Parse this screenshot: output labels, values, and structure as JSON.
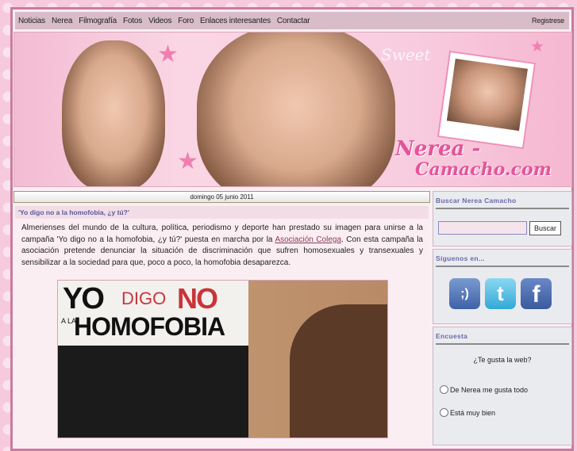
{
  "nav": {
    "items": [
      "Noticias",
      "Nerea",
      "Filmografía",
      "Fotos",
      "Videos",
      "Foro",
      "Enlaces interesantes",
      "Contactar"
    ],
    "register": "Registrese"
  },
  "banner": {
    "logo_line1": "Nerea -",
    "logo_line2": "Camacho.com",
    "sweet": "Sweet"
  },
  "post": {
    "date": "domingo 05 junio 2011",
    "title": "'Yo digo no a la homofobia, ¿y tú?'",
    "text_before": "Almerienses del mundo de la cultura, política, periodismo y deporte han prestado su imagen para unirse a la campaña 'Yo digo no a la homofobia, ¿y tú?' puesta en marcha por la ",
    "link": "Asociación Colega",
    "text_after": ". Con esta campaña la asociación pretende denunciar la situación de discriminación que sufren homosexuales y transexuales y sensibilizar a la sociedad para que, poco a poco, la homofobia desaparezca.",
    "poster": {
      "yo": "YO",
      "digo": "DIGO",
      "no": "NO",
      "a_la": "A LA",
      "homofobia": "HOMOFOBIA"
    }
  },
  "sidebar": {
    "search": {
      "title": "Buscar Nerea Camacho",
      "button": "Buscar",
      "value": ""
    },
    "social": {
      "title": "Síguenos en...",
      "icons": [
        "tuenti-icon",
        "twitter-icon",
        "facebook-icon"
      ]
    },
    "poll": {
      "title": "Encuesta",
      "question": "¿Te gusta la web?",
      "options": [
        "De Nerea me gusta todo",
        "Está muy bien"
      ]
    }
  }
}
